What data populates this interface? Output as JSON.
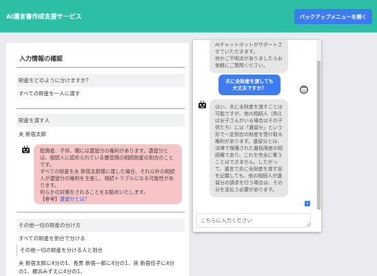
{
  "header": {
    "title": "AI遺言書作成支援サービス",
    "backup_button": "バックアップメニューを開く"
  },
  "confirm_panel": {
    "title": "入力情報の確認",
    "sections": [
      {
        "question": "財産をどのように分けますか？",
        "answer": "すべての財産を一人に渡す"
      },
      {
        "question": "財産を渡す人",
        "answer": "夫 新宿太郎"
      },
      {
        "question": "その他一切の財産の分け方",
        "answer": "すべての財産を割合で分ける",
        "sub_label": "その他一切の財産を分ける人と割合",
        "sub_answer_line1": "夫 新宿太郎に4分の1、長男 新宿一郎に4分の1、孫 新宿佳子に4分",
        "sub_answer_line2": "の1、横浜みずえに4分の1、"
      }
    ],
    "warning": {
      "text": "配偶者、子供、親には遺留分の権利があります。遺留分とは、相続人に認められている最低限の相続財産の割合のことです。\nすべての財産を夫 新宿太郎様に渡した場合、それ以外の相続人が遺留分の権利を主張し、相続トラブルになる可能性があります。\n何らかの対策をされることをお勧めいたします。",
      "ref_prefix": "【参考】",
      "ref_link": "遺留分とは？"
    }
  },
  "chat": {
    "messages": [
      {
        "role": "bot",
        "text": "AIチャットボットがサポートさせていただきます。\n何かご不明点がありましたらお気軽にご質問ください。"
      },
      {
        "role": "user",
        "text": "夫に全財産を渡しても大丈夫ですか？"
      },
      {
        "role": "bot",
        "text": "はい、夫に全財産を渡すことは可能ですが、他の相続人（例えばお子さんがいる場合はその子供たち）には「遺留分」という形で一定割合の財産を受け取る権利があります。遺留分とは、法律で保護された最低限度の相続権であり、これを完全に奪うことはできません。したがって、遺言で夫に全財産を渡す旨を記載しても、他の相続人が遺留分の請求を行う場合は、その分を支払う必要があります。"
      }
    ],
    "input_placeholder": "こちらに入力ください"
  },
  "colors": {
    "header_bg": "#2dbfa5",
    "accent_blue": "#3d7bf0",
    "warning_bg": "#f8c5c6",
    "bot_bubble": "#e6e6e6"
  }
}
